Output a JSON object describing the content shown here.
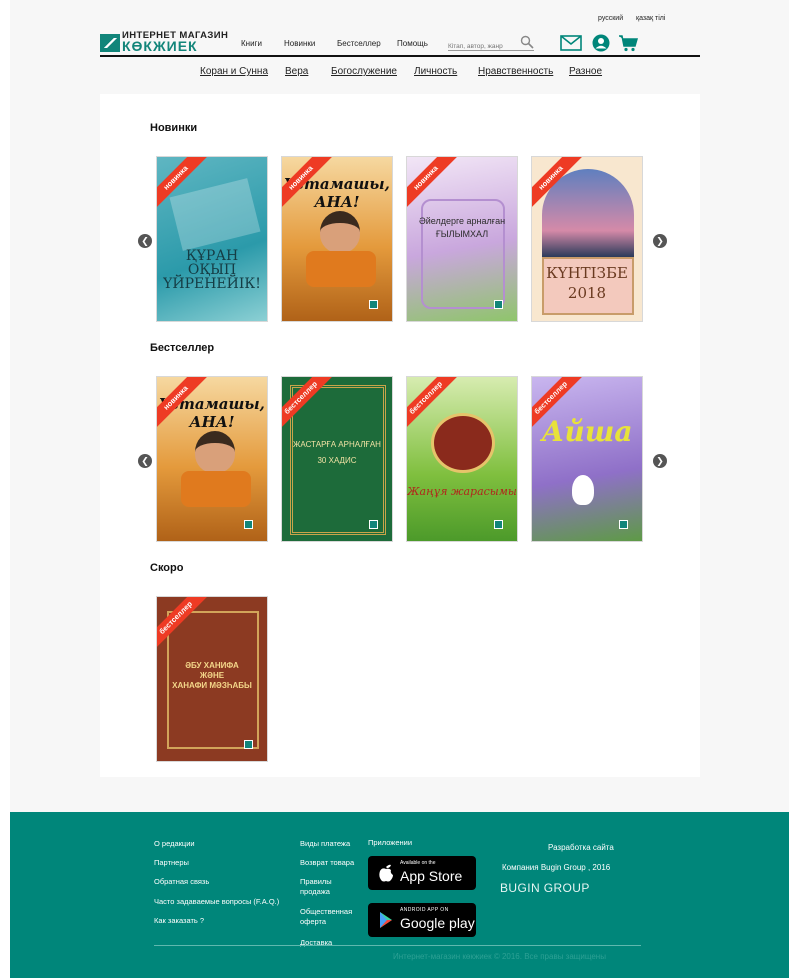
{
  "header": {
    "lang": [
      "русский",
      "қазақ тілі"
    ],
    "logo_top": "ИНТЕРНЕТ МАГАЗИН",
    "logo_bottom": "КӨКЖИЕК",
    "nav": [
      "Книги",
      "Новинки",
      "Бестселлер",
      "Помощь"
    ],
    "search_placeholder": "Кітап, автор, жанр",
    "icons": [
      "mail-icon",
      "user-icon",
      "cart-icon",
      "search-icon"
    ]
  },
  "categories": [
    "Коран и Сунна",
    "Вера",
    "Богослужение",
    "Личность",
    "Нравственность",
    "Разное"
  ],
  "sections": [
    {
      "title": "Новинки",
      "books": [
        {
          "ribbon": "новинка",
          "title": "ҚҰРАН\nОҚЫП ҮЙРЕНЕЙІК!",
          "theme": "quran"
        },
        {
          "ribbon": "новинка",
          "title": "Үстамашы, АНА!",
          "theme": "boy"
        },
        {
          "ribbon": "новинка",
          "title": "Әйелдерге арналған\nҒЫЛЫМХАЛ",
          "theme": "flower"
        },
        {
          "ribbon": "новинка",
          "title": "КҮНТІЗБЕ\n2018",
          "theme": "calendar"
        }
      ]
    },
    {
      "title": "Бестселлер",
      "books": [
        {
          "ribbon": "новинка",
          "title": "Үстамашы, АНА!",
          "theme": "boy"
        },
        {
          "ribbon": "бестселлер",
          "title": "ЖАСТАРҒА АРНАЛҒАН\n30 ХАДИС",
          "theme": "green"
        },
        {
          "ribbon": "бестселлер",
          "title": "Жаңұя жарасымы",
          "theme": "ornament"
        },
        {
          "ribbon": "бестселлер",
          "title": "Айша",
          "theme": "aisha"
        }
      ]
    },
    {
      "title": "Скоро",
      "books": [
        {
          "ribbon": "бестселлер",
          "title": "ӘБУ ХАНИФА\nЖӘНЕ\nХАНАФИ МӘЗҺАБЫ",
          "theme": "brown"
        }
      ]
    }
  ],
  "footer": {
    "col1": [
      "О редакции",
      "Партнеры",
      "Обратная связь",
      "Часто задаваемые вопросы (F.A.Q.)",
      "Как заказать ?"
    ],
    "col2": [
      "Виды платежа",
      "Возврат товара",
      "Правилы продажа",
      "Общественная оферта",
      "Доставка"
    ],
    "apps_title": "Приложении",
    "appstore_small": "Available on the",
    "appstore_big": "App Store",
    "gplay_small": "ANDROID APP ON",
    "gplay_big": "Google play",
    "dev_title": "Разработка сайта",
    "dev_company": "Компания Bugin Group , 2016",
    "dev_logo": "BUGIN GROUP",
    "copyright": "Интернет-магазин көкжиек  © 2016. Все правы защищены"
  },
  "colors": {
    "accent": "#00867a",
    "ribbon": "#ee3b24"
  }
}
